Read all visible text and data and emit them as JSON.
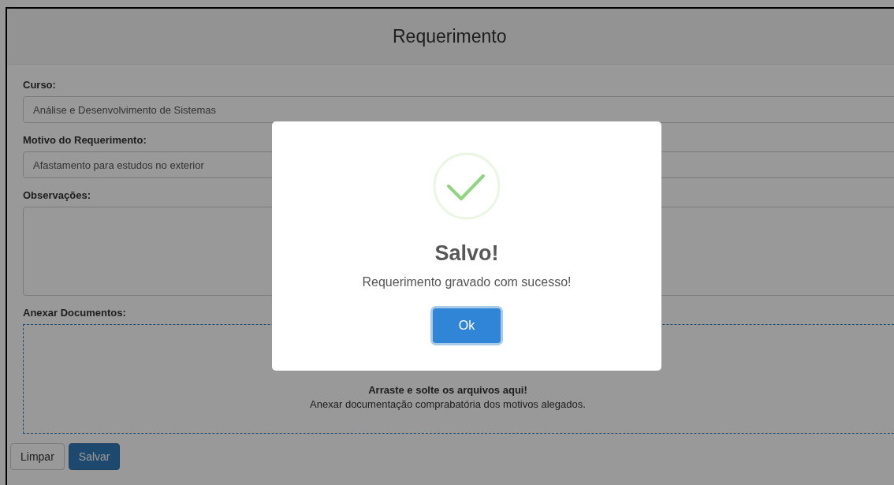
{
  "page": {
    "title": "Requerimento"
  },
  "fields": [
    {
      "kind": "input",
      "label": "Curso:",
      "value": "Análise e Desenvolvimento de Sistemas"
    },
    {
      "kind": "input",
      "label": "Motivo do Requerimento:",
      "value": "Afastamento para estudos no exterior"
    },
    {
      "kind": "textarea",
      "label": "Observações:"
    }
  ],
  "attachment": {
    "label": "Anexar Documentos:",
    "heading": "Arraste e solte os arquivos aqui!",
    "hint": "Anexar documentação comprabatória dos motivos alegados."
  },
  "buttons": [
    {
      "label": "Limpar",
      "kind": "default"
    },
    {
      "label": "Salvar",
      "kind": "primary"
    }
  ],
  "dialog": {
    "title": "Salvo!",
    "message": "Requerimento gravado com sucesso!",
    "button": "Ok"
  }
}
